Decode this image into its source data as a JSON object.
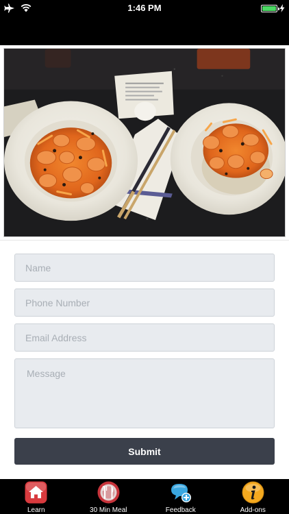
{
  "status_bar": {
    "time": "1:46 PM",
    "left_icons": [
      "airplane-icon",
      "wifi-icon"
    ],
    "right_icons": [
      "battery-icon",
      "charging-bolt-icon"
    ],
    "battery_level": 1.0,
    "battery_color": "#4cd964"
  },
  "photo": {
    "subject": "food-photo"
  },
  "form": {
    "name_placeholder": "Name",
    "phone_placeholder": "Phone Number",
    "email_placeholder": "Email Address",
    "message_placeholder": "Message",
    "submit_label": "Submit",
    "submit_color": "#3b404b"
  },
  "tab_bar": {
    "tabs": [
      {
        "label": "Learn",
        "icon": "house-icon",
        "color": "#d83a3e"
      },
      {
        "label": "30 Min Meal",
        "icon": "fork-knife-icon",
        "color": "#c7343b"
      },
      {
        "label": "Feedback",
        "icon": "chat-bubble-icon",
        "color": "#3aa7e0",
        "active": true
      },
      {
        "label": "Add-ons",
        "icon": "info-icon",
        "color": "#f4a91f"
      }
    ]
  }
}
